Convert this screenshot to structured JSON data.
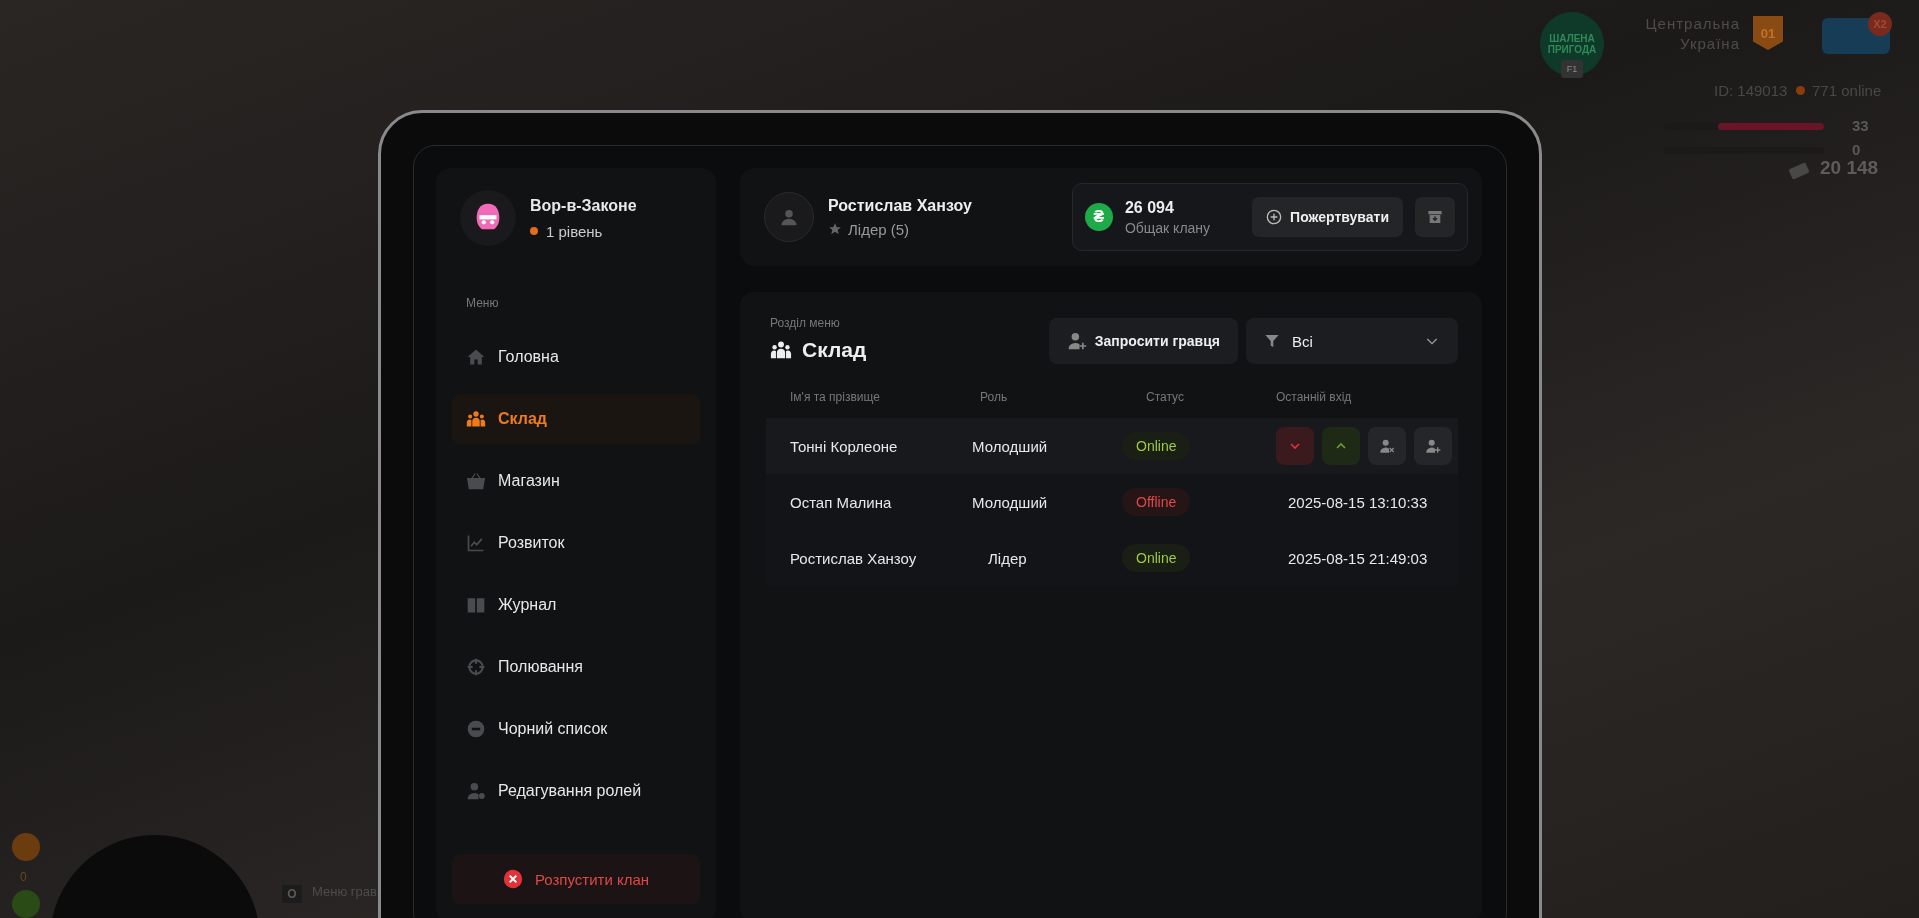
{
  "hud": {
    "logo_text": "ШАЛЕНА ПРИГОДА",
    "logo_key": "F1",
    "location": [
      "Центральна",
      "Україна"
    ],
    "zone_badge": "01",
    "multiplier": "X2",
    "player_id": "ID: 149013",
    "online": "771 online",
    "meters": [
      {
        "kind": "health",
        "level": 0.66,
        "reading": "33"
      },
      {
        "kind": "armor",
        "level": 0,
        "reading": "0"
      }
    ],
    "money": "20 148",
    "hunger_reading": "0",
    "hint_key": "O",
    "hint_text": "Меню грав"
  },
  "sidebar": {
    "clan_name": "Вор-в-Законе",
    "clan_level": "1 рівень",
    "section_label": "Меню",
    "items": [
      {
        "label": "Головна",
        "selected": false
      },
      {
        "label": "Склад",
        "selected": true
      },
      {
        "label": "Магазин",
        "selected": false
      },
      {
        "label": "Розвиток",
        "selected": false
      },
      {
        "label": "Журнал",
        "selected": false
      },
      {
        "label": "Полювання",
        "selected": false
      },
      {
        "label": "Чорний список",
        "selected": false
      },
      {
        "label": "Редагування ролей",
        "selected": false
      }
    ],
    "disband_button": "Розпустити клан"
  },
  "header": {
    "player_name": "Ростислав Ханзоу",
    "player_role": "Лідер (5)",
    "currency_symbol": "₴",
    "balance": "26 094",
    "balance_label": "Общак клану",
    "donate_button": "Пожертвувати"
  },
  "section": {
    "caption": "Розділ меню",
    "title": "Склад",
    "invite_button": "Запросити гравця",
    "filter_value": "Всі"
  },
  "table": {
    "columns": [
      "Ім'я та прізвище",
      "Роль",
      "Статус",
      "Останній вхід"
    ],
    "rows": [
      {
        "name": "Тонні Корлеоне",
        "role": "Молодший",
        "status": "Online",
        "online": true,
        "selected": true
      },
      {
        "name": "Остап Малина",
        "role": "Молодший",
        "status": "Offline",
        "online": false,
        "selected": false,
        "last_login": "2025-08-15 13:10:33"
      },
      {
        "name": "Ростислав Ханзоу",
        "role": "Лідер",
        "status": "Online",
        "online": true,
        "selected": false,
        "last_login": "2025-08-15 21:49:03"
      }
    ]
  }
}
